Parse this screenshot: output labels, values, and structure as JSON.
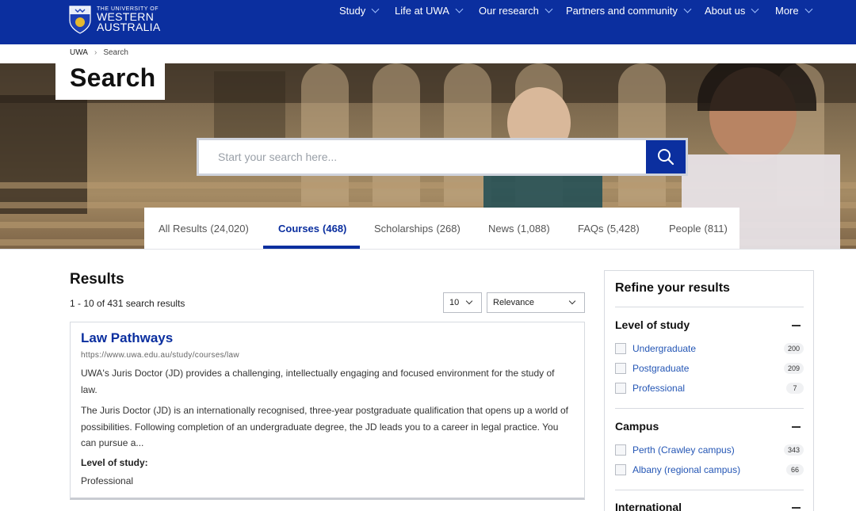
{
  "brand": {
    "logo_small": "THE UNIVERSITY OF",
    "logo_line1": "WESTERN",
    "logo_line2": "AUSTRALIA"
  },
  "nav": {
    "items": [
      {
        "label": "Study"
      },
      {
        "label": "Life at UWA"
      },
      {
        "label": "Our research"
      },
      {
        "label": "Partners and community"
      },
      {
        "label": "About us"
      },
      {
        "label": "More"
      }
    ]
  },
  "breadcrumb": {
    "home": "UWA",
    "current": "Search"
  },
  "page": {
    "title": "Search"
  },
  "search": {
    "placeholder": "Start your search here..."
  },
  "tabs": [
    {
      "label": "All Results",
      "count": "(24,020)"
    },
    {
      "label": "Courses",
      "count": "(468)"
    },
    {
      "label": "Scholarships",
      "count": "(268)"
    },
    {
      "label": "News",
      "count": "(1,088)"
    },
    {
      "label": "FAQs",
      "count": "(5,428)"
    },
    {
      "label": "People",
      "count": "(811)"
    }
  ],
  "results": {
    "title": "Results",
    "count_text": "1 - 10 of 431 search results",
    "per_page": "10",
    "sort": "Relevance"
  },
  "result_card": {
    "title": "Law Pathways",
    "url": "https://www.uwa.edu.au/study/courses/law",
    "para1": "UWA's Juris Doctor (JD) provides a challenging, intellectually engaging and focused environment for the study of law.",
    "para2": "The Juris Doctor (JD) is an internationally recognised, three-year postgraduate qualification that opens up a world of possibilities. Following completion of an undergraduate degree, the JD leads you to a career in legal practice. You can pursue a...",
    "level_label": "Level of study:",
    "level_value": "Professional"
  },
  "refine": {
    "title": "Refine your results",
    "facets": [
      {
        "heading": "Level of study",
        "items": [
          {
            "label": "Undergraduate",
            "count": "200"
          },
          {
            "label": "Postgraduate",
            "count": "209"
          },
          {
            "label": "Professional",
            "count": "7"
          }
        ]
      },
      {
        "heading": "Campus",
        "items": [
          {
            "label": "Perth (Crawley campus)",
            "count": "343"
          },
          {
            "label": "Albany (regional campus)",
            "count": "66"
          }
        ]
      },
      {
        "heading": "International",
        "items": []
      }
    ]
  },
  "colors": {
    "brand_blue": "#0b2f9f",
    "link_blue": "#2456b5"
  }
}
